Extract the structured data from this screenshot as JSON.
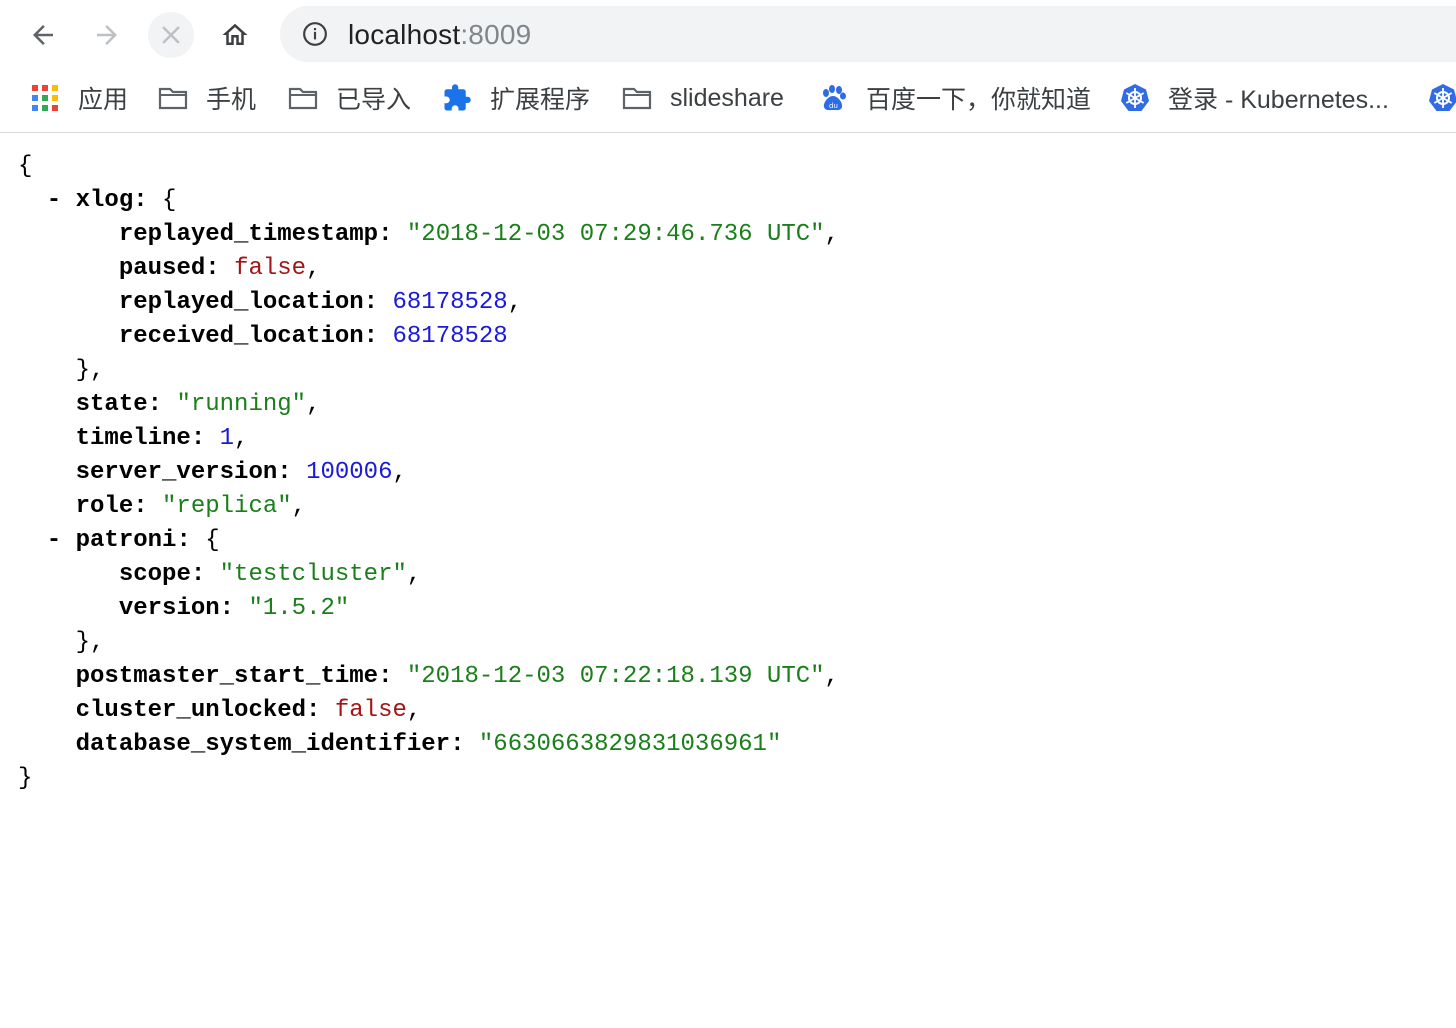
{
  "toolbar": {
    "url_host": "localhost",
    "url_port": ":8009"
  },
  "bookmarks": [
    {
      "label": "应用",
      "icon": "apps-grid-icon"
    },
    {
      "label": "手机",
      "icon": "folder-icon"
    },
    {
      "label": "已导入",
      "icon": "folder-icon"
    },
    {
      "label": "扩展程序",
      "icon": "puzzle-icon"
    },
    {
      "label": "slideshare",
      "icon": "folder-icon"
    },
    {
      "label": "百度一下，你就知道",
      "icon": "baidu-paw-icon"
    },
    {
      "label": "登录 - Kubernetes...",
      "icon": "kubernetes-icon"
    }
  ],
  "json": {
    "open_brace": "{",
    "close_brace": "}",
    "xlog_key": "xlog",
    "xlog_fields": [
      {
        "key": "replayed_timestamp",
        "value": "\"2018-12-03 07:29:46.736 UTC\"",
        "type": "s",
        "comma": ","
      },
      {
        "key": "paused",
        "value": "false",
        "type": "b",
        "comma": ","
      },
      {
        "key": "replayed_location",
        "value": "68178528",
        "type": "n",
        "comma": ","
      },
      {
        "key": "received_location",
        "value": "68178528",
        "type": "n",
        "comma": ""
      }
    ],
    "mid_fields": [
      {
        "key": "state",
        "value": "\"running\"",
        "type": "s",
        "comma": ","
      },
      {
        "key": "timeline",
        "value": "1",
        "type": "n",
        "comma": ","
      },
      {
        "key": "server_version",
        "value": "100006",
        "type": "n",
        "comma": ","
      },
      {
        "key": "role",
        "value": "\"replica\"",
        "type": "s",
        "comma": ","
      }
    ],
    "patroni_key": "patroni",
    "patroni_fields": [
      {
        "key": "scope",
        "value": "\"testcluster\"",
        "type": "s",
        "comma": ","
      },
      {
        "key": "version",
        "value": "\"1.5.2\"",
        "type": "s",
        "comma": ""
      }
    ],
    "tail_fields": [
      {
        "key": "postmaster_start_time",
        "value": "\"2018-12-03 07:22:18.139 UTC\"",
        "type": "s",
        "comma": ","
      },
      {
        "key": "cluster_unlocked",
        "value": "false",
        "type": "b",
        "comma": ","
      },
      {
        "key": "database_system_identifier",
        "value": "\"6630663829831036961\"",
        "type": "s",
        "comma": ""
      }
    ]
  }
}
